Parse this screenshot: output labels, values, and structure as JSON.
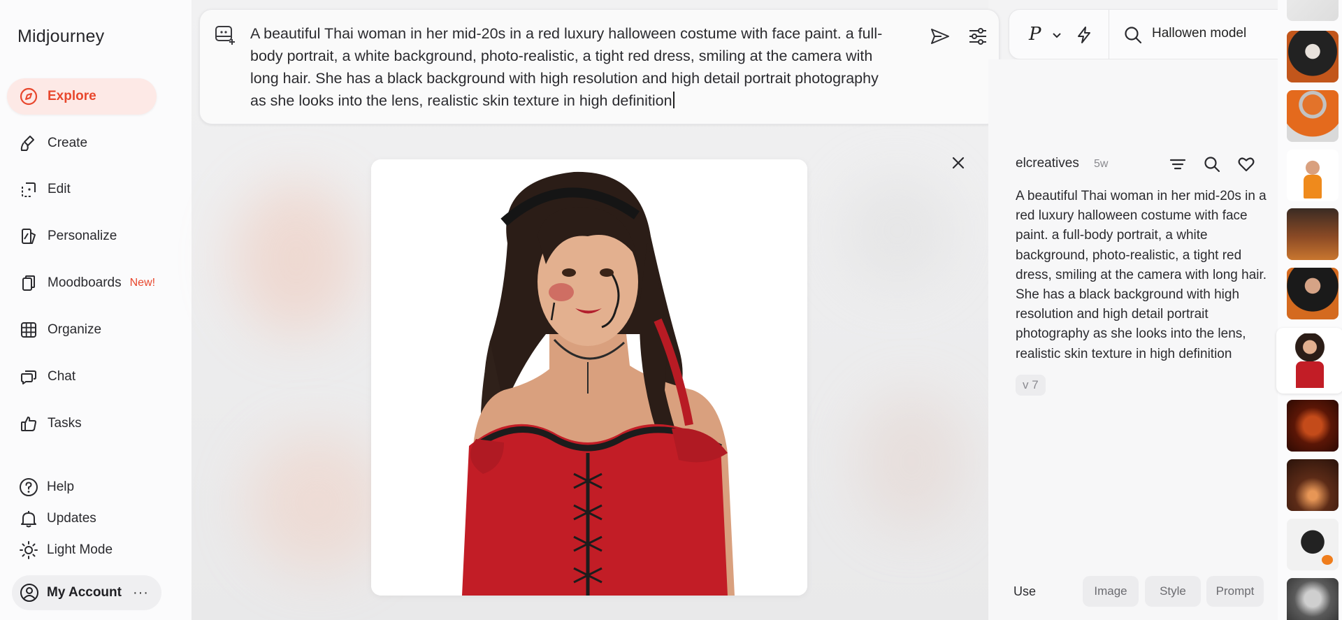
{
  "sidebar": {
    "brand": "Midjourney",
    "items": [
      {
        "label": "Explore",
        "icon": "compass-icon",
        "active": true
      },
      {
        "label": "Create",
        "icon": "brush-icon"
      },
      {
        "label": "Edit",
        "icon": "edit-icon"
      },
      {
        "label": "Personalize",
        "icon": "personalize-icon"
      },
      {
        "label": "Moodboards",
        "icon": "moodboards-icon",
        "badge": "New!"
      },
      {
        "label": "Organize",
        "icon": "grid-icon"
      },
      {
        "label": "Chat",
        "icon": "chat-icon"
      },
      {
        "label": "Tasks",
        "icon": "thumbs-up-icon"
      }
    ],
    "bottom": [
      {
        "label": "Help",
        "icon": "help-icon"
      },
      {
        "label": "Updates",
        "icon": "bell-icon"
      },
      {
        "label": "Light Mode",
        "icon": "sun-icon"
      }
    ],
    "account": {
      "label": "My Account",
      "more": "···"
    }
  },
  "prompt": {
    "text": "A beautiful Thai woman in her mid-20s in a red luxury halloween costume with face paint. a full-body portrait, a white background, photo-realistic, a tight red dress, smiling at the camera with long hair. She has a black background with high resolution and high detail portrait photography as she looks into the lens, realistic skin texture in high definition"
  },
  "topbar": {
    "mode_label": "P",
    "search_value": "Hallowen model"
  },
  "detail": {
    "author": "elcreatives",
    "age": "5w",
    "description": "A beautiful Thai woman in her mid-20s in a red luxury halloween costume with face paint. a full-body portrait, a white background, photo-realistic, a tight red dress, smiling at the camera with long hair. She has a black background with high resolution and high detail portrait photography as she looks into the lens, realistic skin texture in high definition",
    "version": "v 7",
    "use_label": "Use",
    "use_buttons": [
      "Image",
      "Style",
      "Prompt"
    ]
  },
  "colors": {
    "accent": "#e8472d",
    "active_bg": "#fde9e6"
  }
}
